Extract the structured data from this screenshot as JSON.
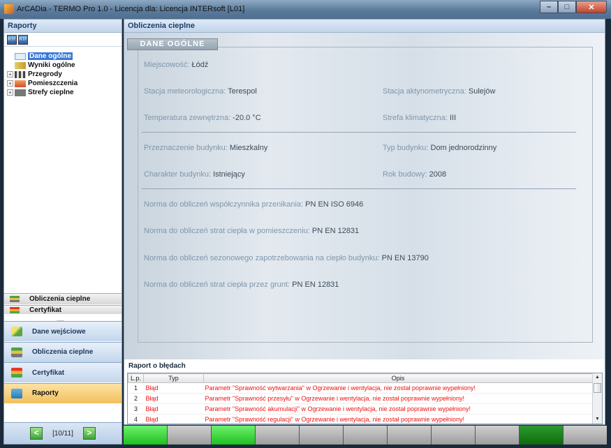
{
  "window": {
    "title": "ArCADia - TERMO Pro 1.0 - Licencja dla: Licencja INTERsoft [L01]",
    "buttons": {
      "minimize": "–",
      "maximize": "□",
      "close": "✕"
    }
  },
  "left": {
    "header": "Raporty",
    "rtf_icons": [
      "RTF",
      "RTF"
    ],
    "tree": [
      {
        "label": "Dane ogólne",
        "expandable": false,
        "selected": true,
        "icon": "dane-icon"
      },
      {
        "label": "Wyniki ogólne",
        "expandable": false,
        "selected": false,
        "icon": "wyniki-icon"
      },
      {
        "label": "Przegrody",
        "expandable": true,
        "selected": false,
        "icon": "przegrody-icon"
      },
      {
        "label": "Pomieszczenia",
        "expandable": true,
        "selected": false,
        "icon": "pomieszczenia-icon"
      },
      {
        "label": "Strefy cieplne",
        "expandable": true,
        "selected": false,
        "icon": "strefy-icon"
      }
    ],
    "expand_glyph": "+",
    "section_bars": [
      "Obliczenia cieplne",
      "Certyfikat"
    ],
    "dots": ".....",
    "nav": [
      {
        "label": "Dane wejściowe",
        "icon": "dane-wejsciowe-icon",
        "active": false
      },
      {
        "label": "Obliczenia cieplne",
        "icon": "obliczenia-icon",
        "active": false
      },
      {
        "label": "Certyfikat",
        "icon": "certyfikat-icon",
        "active": false
      },
      {
        "label": "Raporty",
        "icon": "raporty-icon",
        "active": true
      }
    ],
    "pager": {
      "prev": "<",
      "text": "[10/11]",
      "next": ">"
    }
  },
  "main": {
    "header": "Obliczenia cieplne",
    "tab": "DANE OGÓLNE",
    "fields": {
      "miejscowosc": {
        "label": "Miejscowość: ",
        "value": "Łódź"
      },
      "stacja_met": {
        "label": "Stacja meteorologiczna: ",
        "value": "Terespol"
      },
      "stacja_akt": {
        "label": "Stacja aktynometryczna: ",
        "value": "Sulejów"
      },
      "temp": {
        "label": "Temperatura zewnętrzna: ",
        "value": "-20.0 °C"
      },
      "strefa": {
        "label": "Strefa klimatyczna: ",
        "value": "III"
      },
      "przeznaczenie": {
        "label": "Przeznaczenie budynku: ",
        "value": "Mieszkalny"
      },
      "typ": {
        "label": "Typ budynku: ",
        "value": "Dom jednorodzinny"
      },
      "charakter": {
        "label": "Charakter budynku: ",
        "value": "Istniejący"
      },
      "rok": {
        "label": "Rok budowy: ",
        "value": "2008"
      },
      "norma1": {
        "label": "Norma do obliczeń współczynnika przenikania: ",
        "value": "PN EN ISO 6946"
      },
      "norma2": {
        "label": "Norma do obliczeń strat ciepła w pomieszczeniu: ",
        "value": "PN EN 12831"
      },
      "norma3": {
        "label": "Norma do obliczeń sezonowego zapotrzebowania na ciepło budynku: ",
        "value": "PN EN 13790"
      },
      "norma4": {
        "label": "Norma do obliczeń strat ciepła przez grunt: ",
        "value": "PN EN 12831"
      }
    }
  },
  "report": {
    "title": "Raport o błędach",
    "columns": [
      "L.p.",
      "Typ",
      "Opis"
    ],
    "rows": [
      {
        "lp": "1",
        "typ": "Błąd",
        "opis": "Parametr \"Sprawność wytwarzania\" w Ogrzewanie i wentylacja, nie został poprawnie wypełniony!"
      },
      {
        "lp": "2",
        "typ": "Błąd",
        "opis": "Parametr \"Sprawność przesyłu\" w Ogrzewanie i wentylacja, nie został poprawnie wypełniony!"
      },
      {
        "lp": "3",
        "typ": "Błąd",
        "opis": "Parametr \"Sprawność akumulacji\" w Ogrzewanie i wentylacja, nie został poprawnie wypełniony!"
      },
      {
        "lp": "4",
        "typ": "Błąd",
        "opis": "Parametr \"Sprawność regulacji\" w Ogrzewanie i wentylacja, nie został poprawnie wypełniony!"
      }
    ],
    "scroll_up": "▲",
    "scroll_down": "▼"
  },
  "status_segments": [
    "green",
    "gray",
    "green",
    "gray",
    "gray",
    "gray",
    "gray",
    "gray",
    "gray",
    "dgreen",
    "gray"
  ],
  "colors": {
    "error_text": "#e11111",
    "accent_blue": "#3a78d6",
    "active_nav": "#f2bf5c"
  }
}
